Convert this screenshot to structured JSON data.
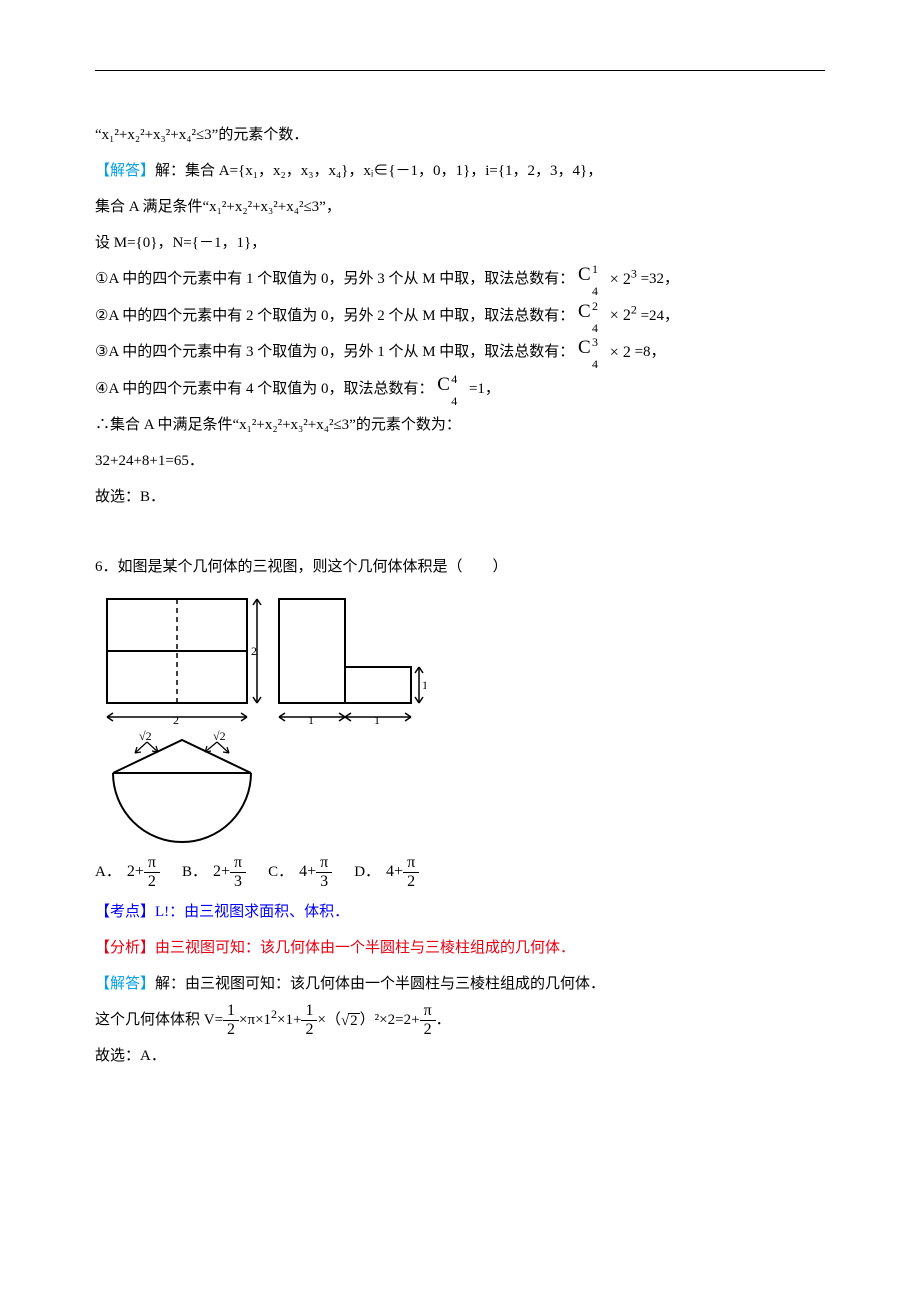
{
  "cont5": {
    "l1": "“x₁²+x₂²+x₃²+x₄²≤3”的元素个数．",
    "tag_solve": "【解答】",
    "l2": "解：集合 A={x₁，x₂，x₃，x₄}，xᵢ∈{－1，0，1}，i={1，2，3，4}，",
    "l3": "集合 A 满足条件“x₁²+x₂²+x₃²+x₄²≤3”，",
    "l4": "设 M={0}，N={－1，1}，",
    "l5a": "①A 中的四个元素中有 1 个取值为 0，另外 3 个从 M 中取，取法总数有：",
    "l5b": "=32，",
    "l6a": "②A 中的四个元素中有 2 个取值为 0，另外 2 个从 M 中取，取法总数有：",
    "l6b": "=24，",
    "l7a": "③A 中的四个元素中有 3 个取值为 0，另外 1 个从 M 中取，取法总数有：",
    "l7b": "=8，",
    "l8a": "④A 中的四个元素中有 4 个取值为 0，取法总数有：",
    "l8b": "=1，",
    "l9": "∴集合 A 中满足条件“x₁²+x₂²+x₃²+x₄²≤3”的元素个数为：",
    "l10": "32+24+8+1=65．",
    "l11": "故选：B．"
  },
  "q6": {
    "stem": "6．如图是某个几何体的三视图，则这个几何体体积是（　　）",
    "optA": "A．",
    "optB": "B．",
    "optC": "C．",
    "optD": "D．",
    "exprA_pre": "2+",
    "exprB_pre": "2+",
    "exprC_pre": "4+",
    "exprD_pre": "4+",
    "pi": "π",
    "two": "2",
    "three": "3",
    "tag_point": "【考点】",
    "point": "L!：由三视图求面积、体积．",
    "tag_ana": "【分析】",
    "ana": "由三视图可知：该几何体由一个半圆柱与三棱柱组成的几何体．",
    "tag_solve": "【解答】",
    "solve1": "解：由三视图可知：该几何体由一个半圆柱与三棱柱组成的几何体．",
    "solve2a": "这个几何体体积 V=",
    "solve2b": "×π×1",
    "solve2c": "×1+",
    "solve2d": "×（",
    "solve2e": "）²×2=2+",
    "solve2end": "．",
    "one": "1",
    "root2": "2",
    "squared": "2",
    "final": "故选：A．"
  }
}
